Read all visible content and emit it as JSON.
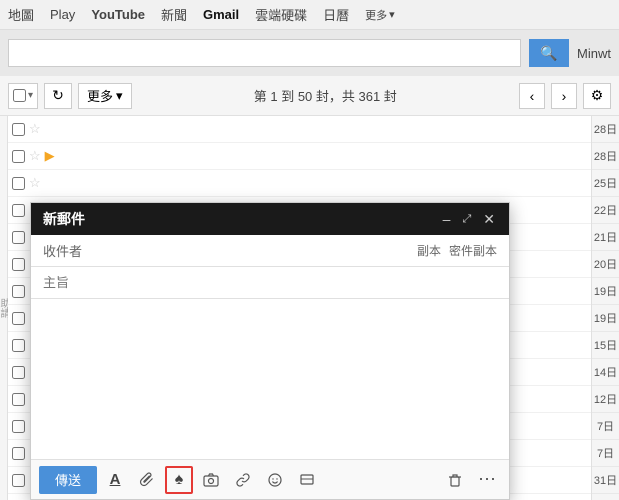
{
  "nav": {
    "items": [
      {
        "label": "地圖",
        "id": "maps"
      },
      {
        "label": "Play",
        "id": "play"
      },
      {
        "label": "YouTube",
        "id": "youtube"
      },
      {
        "label": "新聞",
        "id": "news"
      },
      {
        "label": "Gmail",
        "id": "gmail",
        "active": true
      },
      {
        "label": "雲端硬碟",
        "id": "drive"
      },
      {
        "label": "日曆",
        "id": "calendar"
      },
      {
        "label": "更多",
        "id": "more"
      }
    ]
  },
  "search": {
    "placeholder": "",
    "btn_icon": "🔍",
    "user": "Minwt"
  },
  "toolbar": {
    "refresh_icon": "↻",
    "more_label": "更多",
    "more_arrow": "▾",
    "page_info": "第 1 到 50 封，共 361 封",
    "prev_icon": "‹",
    "next_icon": "›",
    "settings_icon": "⚙"
  },
  "email_rows": [
    {
      "date": "28日",
      "has_folder": false,
      "star": false
    },
    {
      "date": "28日",
      "has_folder": true,
      "star": false
    },
    {
      "date": "25日",
      "has_folder": false,
      "star": false
    },
    {
      "date": "22日",
      "has_folder": false,
      "star": false
    },
    {
      "date": "21日",
      "has_folder": false,
      "star": false
    },
    {
      "date": "20日",
      "has_folder": false,
      "star": false
    },
    {
      "date": "19日",
      "has_folder": true,
      "star": false
    },
    {
      "date": "19日",
      "has_folder": false,
      "star": false
    },
    {
      "date": "15日",
      "has_folder": true,
      "star": false
    },
    {
      "date": "14日",
      "has_folder": true,
      "star": true
    },
    {
      "date": "12日",
      "has_folder": true,
      "star": true
    },
    {
      "date": "7日",
      "has_folder": false,
      "star": false
    },
    {
      "date": "7日",
      "has_folder": false,
      "star": false
    },
    {
      "date": "31日",
      "has_folder": true,
      "star": false
    }
  ],
  "compose": {
    "title": "新郵件",
    "minimize_icon": "–",
    "resize_icon": "⤢",
    "close_icon": "✕",
    "to_label": "收件者",
    "cc_label": "副本",
    "bcc_label": "密件副本",
    "subject_label": "主旨",
    "send_label": "傳送",
    "toolbar_icons": {
      "format": "A",
      "attach": "📎",
      "drive": "♠",
      "photo": "📷",
      "link": "🔗",
      "emoji": "😊",
      "comment": "⊟",
      "delete": "🗑",
      "more": "⋯"
    }
  }
}
